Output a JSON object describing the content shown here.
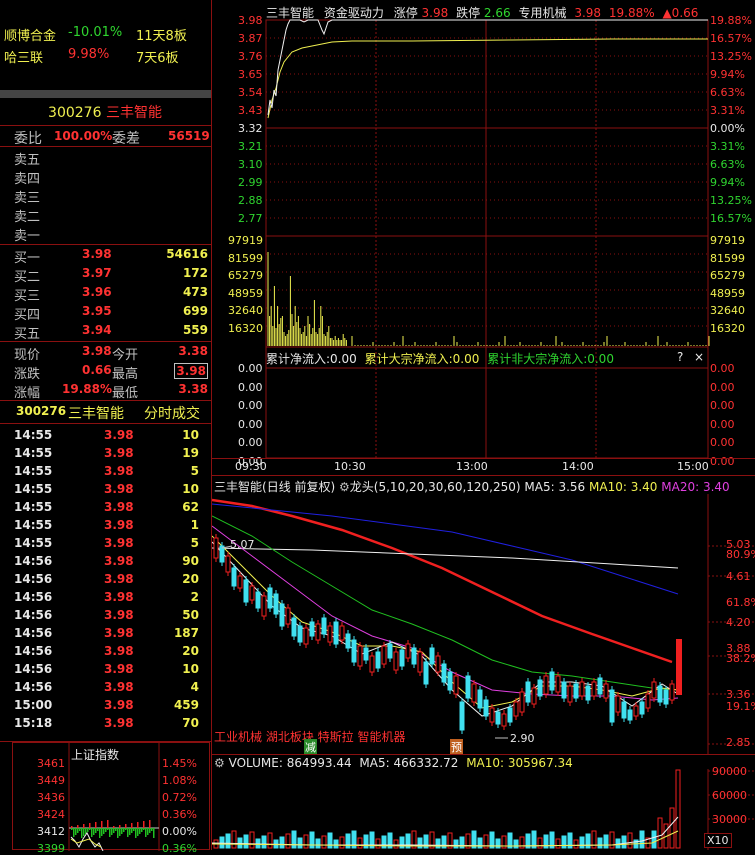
{
  "watchlist": [
    {
      "name": "顺博合金",
      "pct": "-10.01%",
      "streak": "11天8板"
    },
    {
      "name": "哈三联",
      "pct": "9.98%",
      "streak": "7天6板"
    }
  ],
  "quote": {
    "code": "300276",
    "name": "三丰智能",
    "weibi_label": "委比",
    "weibi": "100.00%",
    "weicha_label": "委差",
    "weicha": "56519",
    "sells": [
      {
        "label": "卖五"
      },
      {
        "label": "卖四"
      },
      {
        "label": "卖三"
      },
      {
        "label": "卖二"
      },
      {
        "label": "卖一"
      }
    ],
    "buys": [
      {
        "label": "买一",
        "price": "3.98",
        "vol": "54616"
      },
      {
        "label": "买二",
        "price": "3.97",
        "vol": "172"
      },
      {
        "label": "买三",
        "price": "3.96",
        "vol": "473"
      },
      {
        "label": "买四",
        "price": "3.95",
        "vol": "699"
      },
      {
        "label": "买五",
        "price": "3.94",
        "vol": "559"
      }
    ],
    "stats": [
      {
        "l1": "现价",
        "v1": "3.98",
        "l2": "今开",
        "v2": "3.38"
      },
      {
        "l1": "涨跌",
        "v1": "0.66",
        "l2": "最高",
        "v2": "3.98"
      },
      {
        "l1": "涨幅",
        "v1": "19.88%",
        "l2": "最低",
        "v2": "3.38"
      }
    ]
  },
  "ticks_header": {
    "code": "300276",
    "name": "三丰智能",
    "title": "分时成交"
  },
  "ticks": [
    {
      "t": "14:55",
      "p": "3.98",
      "v": "10"
    },
    {
      "t": "14:55",
      "p": "3.98",
      "v": "19"
    },
    {
      "t": "14:55",
      "p": "3.98",
      "v": "5"
    },
    {
      "t": "14:55",
      "p": "3.98",
      "v": "10"
    },
    {
      "t": "14:55",
      "p": "3.98",
      "v": "62"
    },
    {
      "t": "14:55",
      "p": "3.98",
      "v": "1"
    },
    {
      "t": "14:55",
      "p": "3.98",
      "v": "5"
    },
    {
      "t": "14:56",
      "p": "3.98",
      "v": "90"
    },
    {
      "t": "14:56",
      "p": "3.98",
      "v": "20"
    },
    {
      "t": "14:56",
      "p": "3.98",
      "v": "2"
    },
    {
      "t": "14:56",
      "p": "3.98",
      "v": "50"
    },
    {
      "t": "14:56",
      "p": "3.98",
      "v": "187"
    },
    {
      "t": "14:56",
      "p": "3.98",
      "v": "20"
    },
    {
      "t": "14:56",
      "p": "3.98",
      "v": "10"
    },
    {
      "t": "14:56",
      "p": "3.98",
      "v": "4"
    },
    {
      "t": "15:00",
      "p": "3.98",
      "v": "459"
    },
    {
      "t": "15:18",
      "p": "3.98",
      "v": "70"
    }
  ],
  "mini_index": {
    "title": "上证指数",
    "prices": [
      "3461",
      "3449",
      "3436",
      "3424",
      "3412",
      "3399"
    ],
    "pcts": [
      "1.45%",
      "1.08%",
      "0.72%",
      "0.36%",
      "0.00%",
      "0.36%"
    ]
  },
  "intraday": {
    "header": {
      "name": "三丰智能",
      "tag1": "资金驱动力",
      "zt_label": "涨停",
      "zt": "3.98",
      "dt_label": "跌停",
      "dt": "2.66",
      "sector": "专用机械",
      "price": "3.98",
      "pct": "19.88%",
      "chg": "▲0.66"
    },
    "price_ticks": [
      "3.98",
      "3.87",
      "3.76",
      "3.65",
      "3.54",
      "3.43",
      "3.32",
      "3.21",
      "3.10",
      "2.99",
      "2.88",
      "2.77"
    ],
    "pct_ticks": [
      "19.88%",
      "16.57%",
      "13.25%",
      "9.94%",
      "6.63%",
      "3.31%",
      "0.00%",
      "3.31%",
      "6.63%",
      "9.94%",
      "13.25%",
      "16.57%"
    ],
    "vol_ticks": [
      "97919",
      "81599",
      "65279",
      "48959",
      "32640",
      "16320"
    ],
    "flow_header": {
      "a": "累计净流入:0.00",
      "b": "累计大宗净流入:0.00",
      "c": "累计非大宗净流入:0.00"
    },
    "flow_ticks": [
      "0.00",
      "0.00",
      "0.00",
      "0.00",
      "0.00",
      "0.00"
    ],
    "time_ticks": [
      "09:30",
      "10:30",
      "13:00",
      "14:00",
      "15:00"
    ]
  },
  "kline": {
    "header": {
      "name": "三丰智能",
      "period": "(日线 前复权)",
      "indicator": "龙头(5,10,20,30,60,120,250)",
      "ma5": "MA5: 3.56",
      "ma10": "MA10: 3.40",
      "ma20": "MA20: 3.40"
    },
    "right_ticks": [
      "5.03",
      "80.9%",
      "4.61",
      "61.8%",
      "4.20",
      "3.88",
      "38.2%",
      "3.36",
      "19.1%",
      "2.85"
    ],
    "high_label": "5.07",
    "low_label": "2.90",
    "concepts": "工业机械 湖北板块 特斯拉 智能机器",
    "mark1": "减",
    "mark2": "预"
  },
  "volume": {
    "header": {
      "vol": "VOLUME: 864993.44",
      "ma5": "MA5: 466332.72",
      "ma10": "MA10: 305967.34"
    },
    "ticks": [
      "90000",
      "60000",
      "30000"
    ],
    "unit": "X10"
  }
}
